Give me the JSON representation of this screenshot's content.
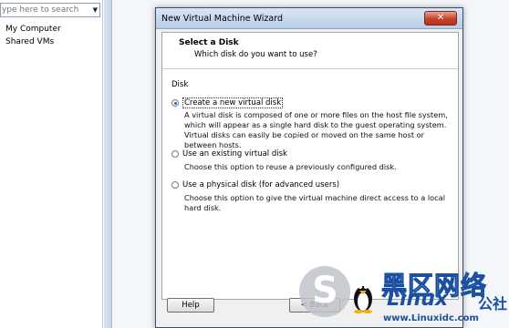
{
  "library": {
    "search_placeholder": "ype here to search",
    "items": [
      "My Computer",
      "Shared VMs"
    ]
  },
  "dialog": {
    "title": "New Virtual Machine Wizard",
    "close_glyph": "✕",
    "header_title": "Select a Disk",
    "header_subtitle": "Which disk do you want to use?",
    "group_label": "Disk",
    "options": [
      {
        "label": "Create a new virtual disk",
        "selected": true,
        "description": "A virtual disk is composed of one or more files on the host file system, which will appear as a single hard disk to the guest operating system. Virtual disks can easily be copied or moved on the same host or between hosts."
      },
      {
        "label": "Use an existing virtual disk",
        "selected": false,
        "description": "Choose this option to reuse a previously configured disk."
      },
      {
        "label": "Use a physical disk (for advanced users)",
        "selected": false,
        "description": "Choose this option to give the virtual machine direct access to a local hard disk."
      }
    ],
    "buttons": {
      "help": "Help",
      "back": "< Back"
    }
  },
  "watermark": {
    "logo_letter": "S",
    "cn_title": "黑区网络",
    "brand": "Linux",
    "she": "公社",
    "url": "www.Linuxidc.com"
  },
  "colors": {
    "title_bar": "#c8d8ec",
    "selected_radio": "#2a62b0",
    "watermark_blue": "#1b4fa0",
    "close_button": "#c8412a"
  }
}
